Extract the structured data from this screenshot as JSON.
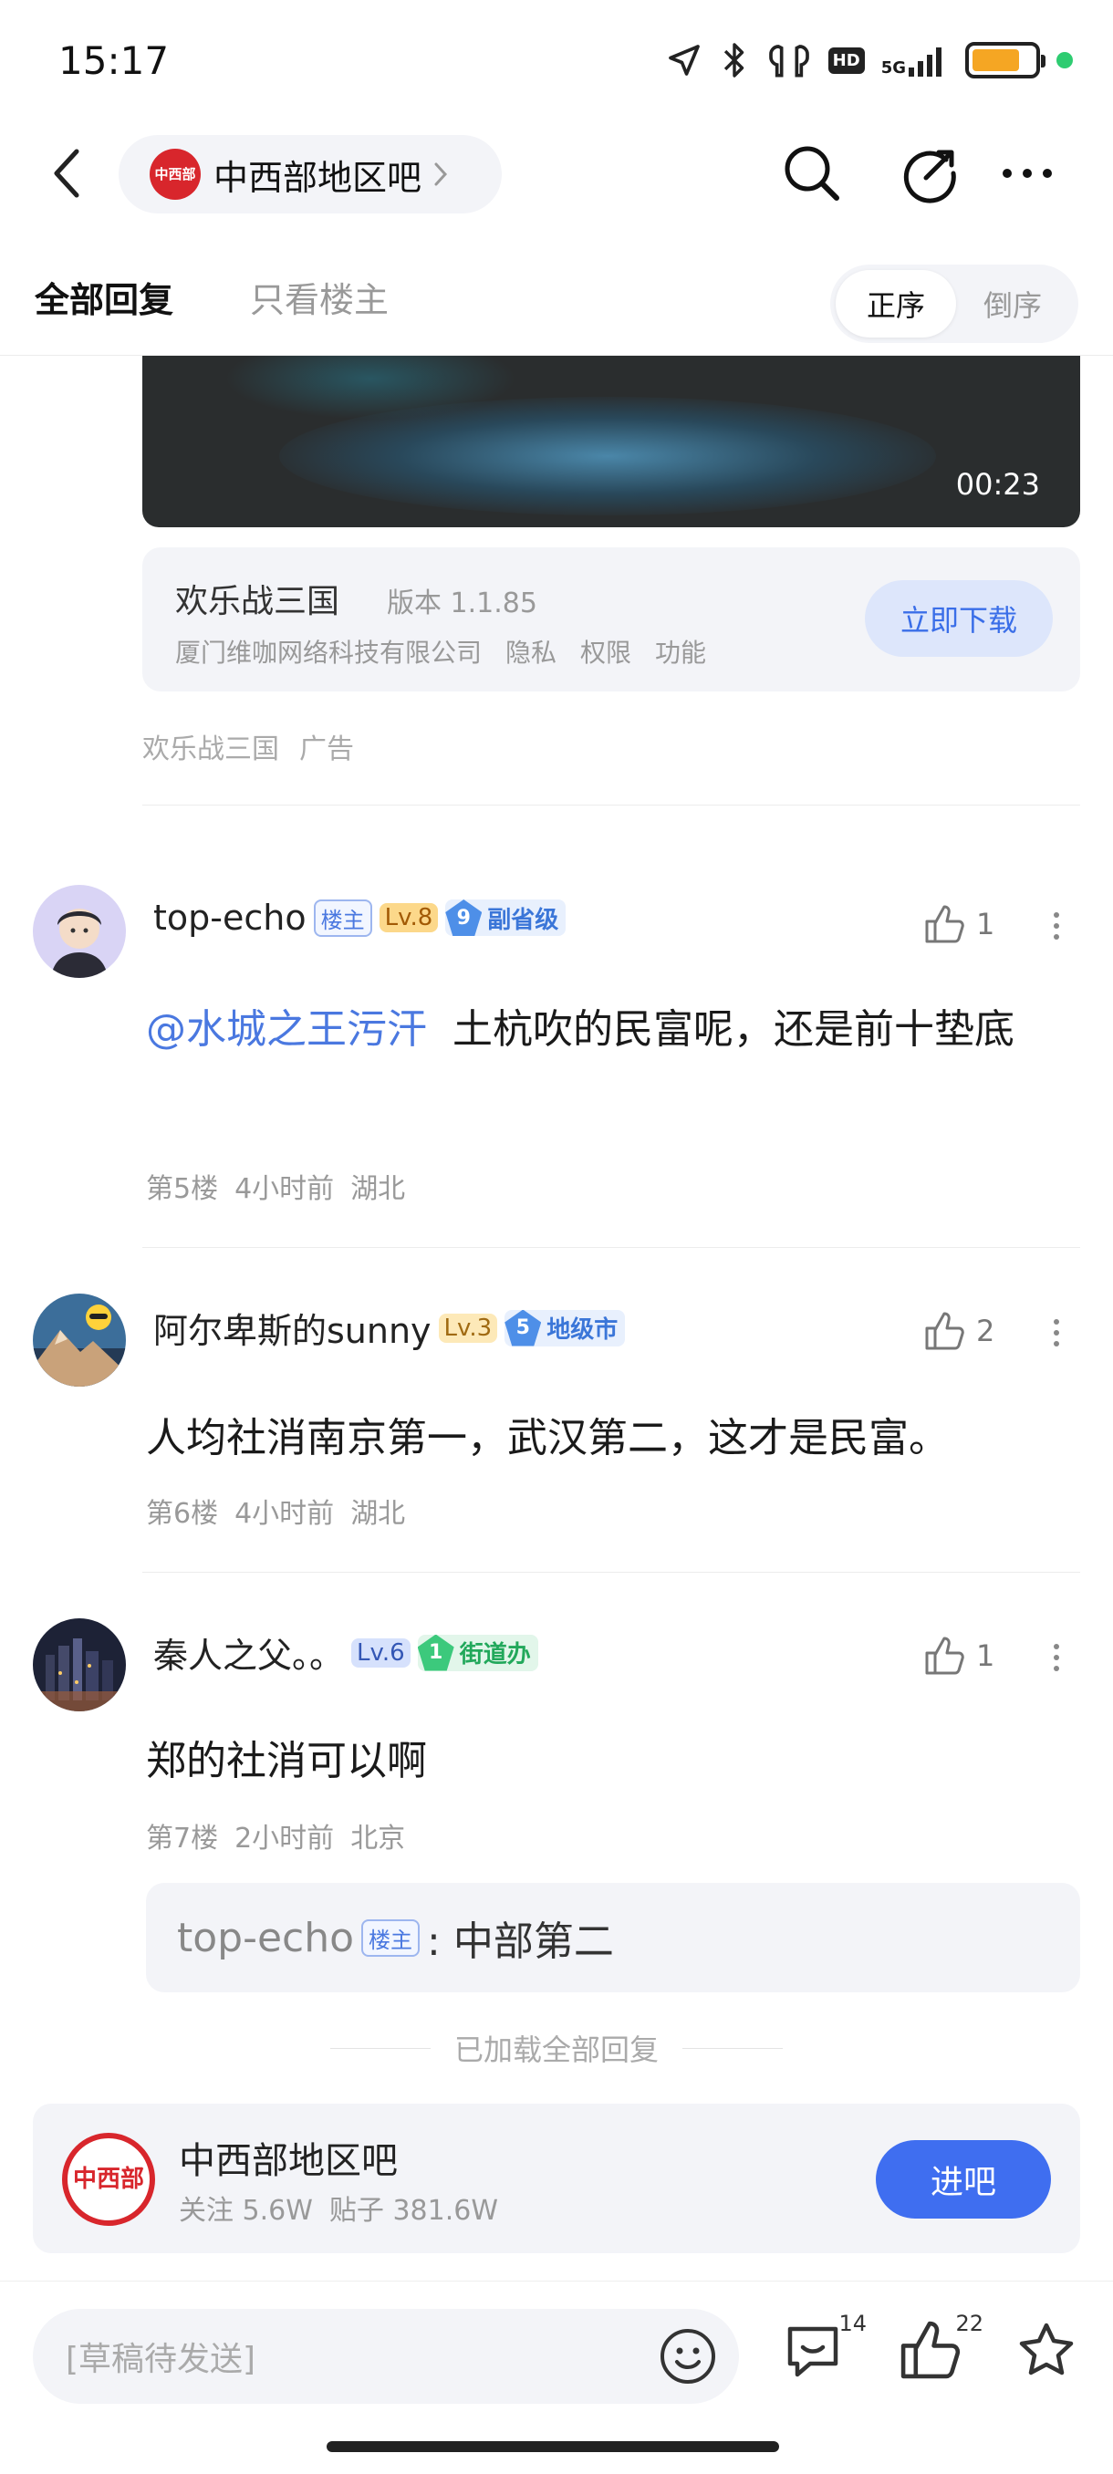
{
  "status_bar": {
    "time": "15:17",
    "icons": [
      "location-arrow-icon",
      "bluetooth-icon",
      "earbuds-icon",
      "hd-icon",
      "5g-signal-icon",
      "battery-icon",
      "privacy-dot-icon"
    ],
    "hd": "HD",
    "network": "5G",
    "battery_color": "#f5a623",
    "dot_color": "#2ecc71"
  },
  "header": {
    "bar_name": "中西部地区吧",
    "bar_seal": "中西部"
  },
  "tabs": {
    "all_replies": "全部回复",
    "op_only": "只看楼主",
    "sort_asc": "正序",
    "sort_desc": "倒序"
  },
  "video": {
    "duration": "00:23"
  },
  "ad": {
    "app_name": "欢乐战三国",
    "version": "版本 1.1.85",
    "company": "厦门维咖网络科技有限公司",
    "privacy": "隐私",
    "permissions": "权限",
    "features": "功能",
    "download": "立即下载",
    "source": "欢乐战三国",
    "ad_label": "广告"
  },
  "comments": [
    {
      "username": "top-echo",
      "op_badge": "楼主",
      "level": "Lv.8",
      "rank_num": "9",
      "rank_name": "副省级",
      "likes": "1",
      "mention": "@水城之王污汗",
      "text": "土杭吹的民富呢，还是前十垫底",
      "floor": "第5楼",
      "time": "4小时前",
      "location": "湖北"
    },
    {
      "username": "阿尔卑斯的sunny",
      "level": "Lv.3",
      "rank_num": "5",
      "rank_name": "地级市",
      "likes": "2",
      "text": "人均社消南京第一，武汉第二，这才是民富。",
      "floor": "第6楼",
      "time": "4小时前",
      "location": "湖北"
    },
    {
      "username": "秦人之父。。",
      "level": "Lv.6",
      "rank_num": "1",
      "rank_name": "街道办",
      "likes": "1",
      "text": "郑的社消可以啊",
      "floor": "第7楼",
      "time": "2小时前",
      "location": "北京",
      "sub_reply": {
        "username": "top-echo",
        "op_badge": "楼主",
        "text": ": 中部第二"
      }
    }
  ],
  "loaded_all": "已加载全部回复",
  "bar_card": {
    "name": "中西部地区吧",
    "seal": "中西部",
    "followers": "关注 5.6W",
    "posts": "贴子 381.6W",
    "enter": "进吧"
  },
  "bottom_bar": {
    "draft_placeholder": "[草稿待发送]",
    "comment_count": "14",
    "like_count": "22"
  }
}
